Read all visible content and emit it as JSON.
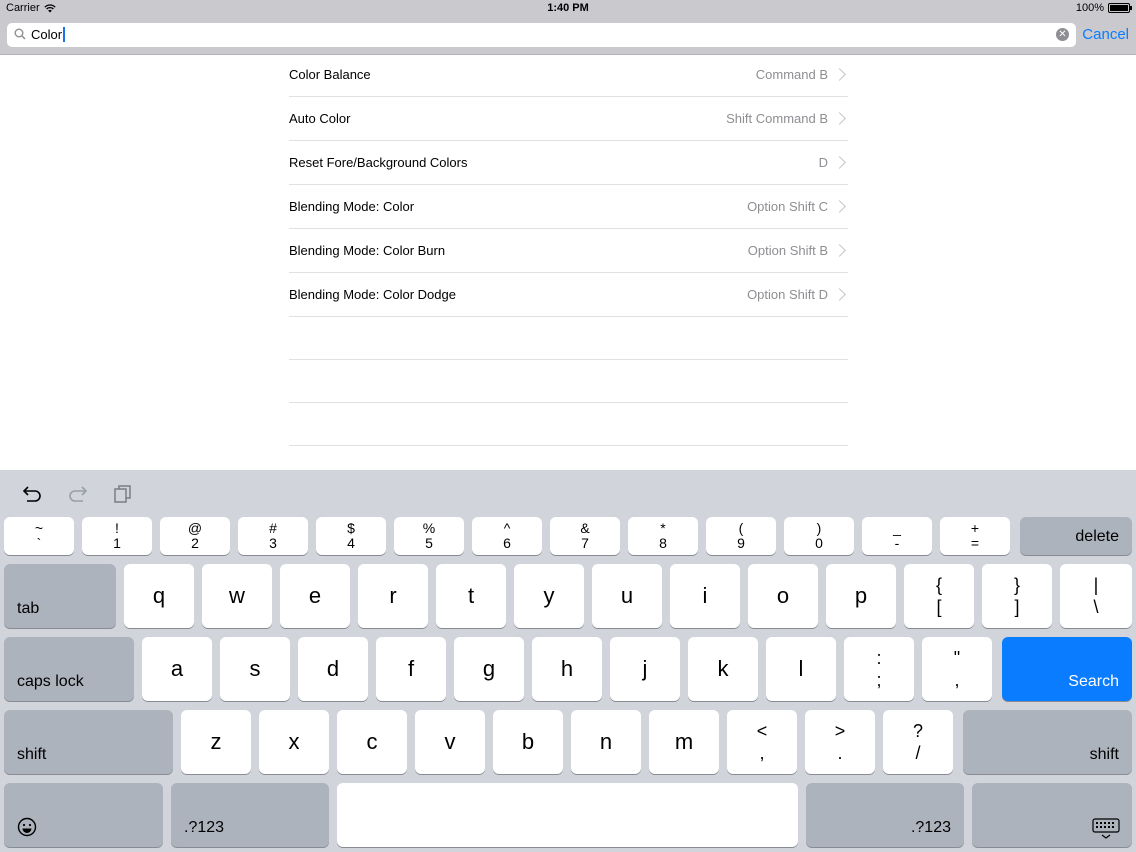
{
  "status": {
    "carrier": "Carrier",
    "time": "1:40 PM",
    "battery": "100%"
  },
  "search": {
    "value": "Color",
    "cancel_label": "Cancel"
  },
  "results": [
    {
      "label": "Color Balance",
      "shortcut": "Command B"
    },
    {
      "label": "Auto Color",
      "shortcut": "Shift Command B"
    },
    {
      "label": "Reset Fore/Background Colors",
      "shortcut": "D"
    },
    {
      "label": "Blending Mode: Color",
      "shortcut": "Option Shift C"
    },
    {
      "label": "Blending Mode: Color Burn",
      "shortcut": "Option Shift B"
    },
    {
      "label": "Blending Mode: Color Dodge",
      "shortcut": "Option Shift D"
    }
  ],
  "keyboard": {
    "number_row": [
      {
        "top": "~",
        "bottom": "`"
      },
      {
        "top": "!",
        "bottom": "1"
      },
      {
        "top": "@",
        "bottom": "2"
      },
      {
        "top": "#",
        "bottom": "3"
      },
      {
        "top": "$",
        "bottom": "4"
      },
      {
        "top": "%",
        "bottom": "5"
      },
      {
        "top": "^",
        "bottom": "6"
      },
      {
        "top": "&",
        "bottom": "7"
      },
      {
        "top": "*",
        "bottom": "8"
      },
      {
        "top": "(",
        "bottom": "9"
      },
      {
        "top": ")",
        "bottom": "0"
      },
      {
        "top": "_",
        "bottom": "-"
      },
      {
        "top": "+",
        "bottom": "="
      }
    ],
    "delete": "delete",
    "tab": "tab",
    "row_q": [
      "q",
      "w",
      "e",
      "r",
      "t",
      "y",
      "u",
      "i",
      "o",
      "p"
    ],
    "row_q_extra": [
      {
        "top": "{",
        "bottom": "["
      },
      {
        "top": "}",
        "bottom": "]"
      },
      {
        "top": "|",
        "bottom": "\\"
      }
    ],
    "caps": "caps lock",
    "row_a": [
      "a",
      "s",
      "d",
      "f",
      "g",
      "h",
      "j",
      "k",
      "l"
    ],
    "row_a_extra": [
      {
        "top": ":",
        "bottom": ";"
      },
      {
        "top": "\"",
        "bottom": ","
      }
    ],
    "search": "Search",
    "shift": "shift",
    "row_z": [
      "z",
      "x",
      "c",
      "v",
      "b",
      "n",
      "m"
    ],
    "row_z_extra": [
      {
        "top": "<",
        "bottom": ","
      },
      {
        "top": ">",
        "bottom": "."
      },
      {
        "top": "?",
        "bottom": "/"
      }
    ],
    "num_switch": ".?123"
  },
  "colors": {
    "accent": "#0a7cff",
    "keyboard_bg": "#d1d5db",
    "bar_bg": "#c9c9ce"
  }
}
